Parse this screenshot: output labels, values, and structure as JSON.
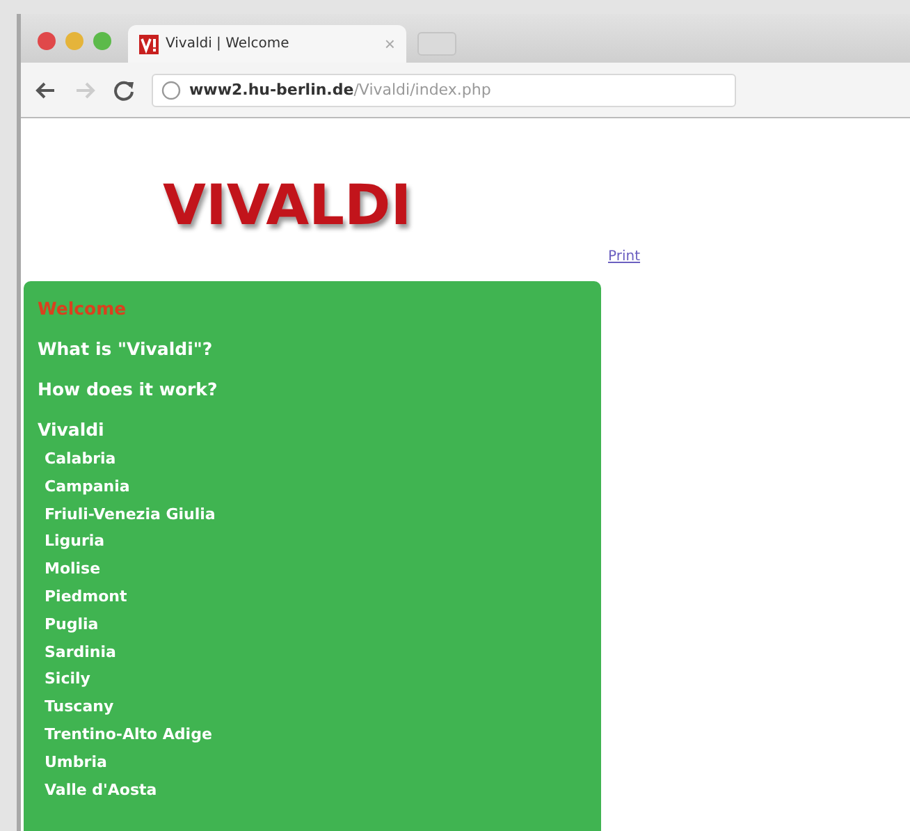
{
  "window": {
    "tab": {
      "title": "Vivaldi | Welcome",
      "close": "×"
    },
    "toolbar": {
      "back_disabled": false,
      "forward_disabled": true,
      "url": "**www2.hu-berlin.de**/Vivaldi/index.php"
    }
  },
  "page": {
    "logo": "VIVALDI",
    "print_link": "Print",
    "nav": [
      {
        "label": "Welcome",
        "selected": true
      },
      {
        "label": "What is \"Vivaldi\"?",
        "selected": false
      },
      {
        "label": "How does it work?",
        "selected": false
      },
      {
        "label": "Vivaldi",
        "selected": false,
        "children": [
          {
            "label": "Calabria",
            "selected": false
          },
          {
            "label": "Campania",
            "selected": false
          },
          {
            "label": "Friuli-Venezia Giulia",
            "selected": false
          },
          {
            "label": "Liguria",
            "selected": false
          },
          {
            "label": "Molise",
            "selected": false
          },
          {
            "label": "Piedmont",
            "selected": false
          },
          {
            "label": "Puglia",
            "selected": false
          },
          {
            "label": "Sardinia",
            "selected": false
          },
          {
            "label": "Sicily",
            "selected": false
          },
          {
            "label": "Tuscany",
            "selected": false
          },
          {
            "label": "Trentino-Alto Adige",
            "selected": false
          },
          {
            "label": "Umbria",
            "selected": false
          },
          {
            "label": "Valle d'Aosta",
            "selected": false
          }
        ]
      }
    ]
  }
}
